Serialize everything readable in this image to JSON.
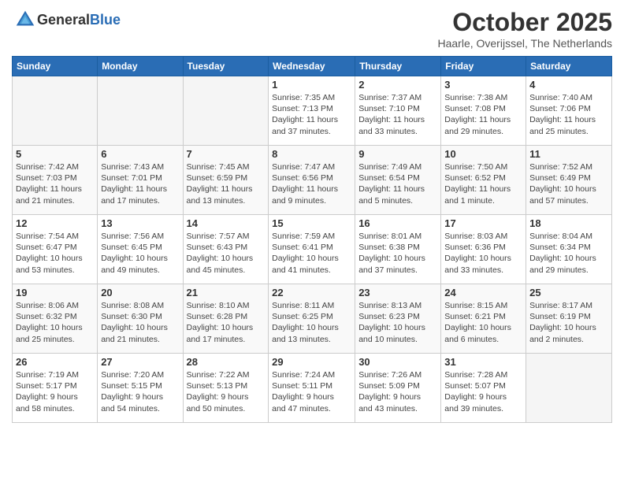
{
  "header": {
    "logo_general": "General",
    "logo_blue": "Blue",
    "month": "October 2025",
    "location": "Haarle, Overijssel, The Netherlands"
  },
  "weekdays": [
    "Sunday",
    "Monday",
    "Tuesday",
    "Wednesday",
    "Thursday",
    "Friday",
    "Saturday"
  ],
  "weeks": [
    [
      {
        "day": "",
        "info": ""
      },
      {
        "day": "",
        "info": ""
      },
      {
        "day": "",
        "info": ""
      },
      {
        "day": "1",
        "info": "Sunrise: 7:35 AM\nSunset: 7:13 PM\nDaylight: 11 hours\nand 37 minutes."
      },
      {
        "day": "2",
        "info": "Sunrise: 7:37 AM\nSunset: 7:10 PM\nDaylight: 11 hours\nand 33 minutes."
      },
      {
        "day": "3",
        "info": "Sunrise: 7:38 AM\nSunset: 7:08 PM\nDaylight: 11 hours\nand 29 minutes."
      },
      {
        "day": "4",
        "info": "Sunrise: 7:40 AM\nSunset: 7:06 PM\nDaylight: 11 hours\nand 25 minutes."
      }
    ],
    [
      {
        "day": "5",
        "info": "Sunrise: 7:42 AM\nSunset: 7:03 PM\nDaylight: 11 hours\nand 21 minutes."
      },
      {
        "day": "6",
        "info": "Sunrise: 7:43 AM\nSunset: 7:01 PM\nDaylight: 11 hours\nand 17 minutes."
      },
      {
        "day": "7",
        "info": "Sunrise: 7:45 AM\nSunset: 6:59 PM\nDaylight: 11 hours\nand 13 minutes."
      },
      {
        "day": "8",
        "info": "Sunrise: 7:47 AM\nSunset: 6:56 PM\nDaylight: 11 hours\nand 9 minutes."
      },
      {
        "day": "9",
        "info": "Sunrise: 7:49 AM\nSunset: 6:54 PM\nDaylight: 11 hours\nand 5 minutes."
      },
      {
        "day": "10",
        "info": "Sunrise: 7:50 AM\nSunset: 6:52 PM\nDaylight: 11 hours\nand 1 minute."
      },
      {
        "day": "11",
        "info": "Sunrise: 7:52 AM\nSunset: 6:49 PM\nDaylight: 10 hours\nand 57 minutes."
      }
    ],
    [
      {
        "day": "12",
        "info": "Sunrise: 7:54 AM\nSunset: 6:47 PM\nDaylight: 10 hours\nand 53 minutes."
      },
      {
        "day": "13",
        "info": "Sunrise: 7:56 AM\nSunset: 6:45 PM\nDaylight: 10 hours\nand 49 minutes."
      },
      {
        "day": "14",
        "info": "Sunrise: 7:57 AM\nSunset: 6:43 PM\nDaylight: 10 hours\nand 45 minutes."
      },
      {
        "day": "15",
        "info": "Sunrise: 7:59 AM\nSunset: 6:41 PM\nDaylight: 10 hours\nand 41 minutes."
      },
      {
        "day": "16",
        "info": "Sunrise: 8:01 AM\nSunset: 6:38 PM\nDaylight: 10 hours\nand 37 minutes."
      },
      {
        "day": "17",
        "info": "Sunrise: 8:03 AM\nSunset: 6:36 PM\nDaylight: 10 hours\nand 33 minutes."
      },
      {
        "day": "18",
        "info": "Sunrise: 8:04 AM\nSunset: 6:34 PM\nDaylight: 10 hours\nand 29 minutes."
      }
    ],
    [
      {
        "day": "19",
        "info": "Sunrise: 8:06 AM\nSunset: 6:32 PM\nDaylight: 10 hours\nand 25 minutes."
      },
      {
        "day": "20",
        "info": "Sunrise: 8:08 AM\nSunset: 6:30 PM\nDaylight: 10 hours\nand 21 minutes."
      },
      {
        "day": "21",
        "info": "Sunrise: 8:10 AM\nSunset: 6:28 PM\nDaylight: 10 hours\nand 17 minutes."
      },
      {
        "day": "22",
        "info": "Sunrise: 8:11 AM\nSunset: 6:25 PM\nDaylight: 10 hours\nand 13 minutes."
      },
      {
        "day": "23",
        "info": "Sunrise: 8:13 AM\nSunset: 6:23 PM\nDaylight: 10 hours\nand 10 minutes."
      },
      {
        "day": "24",
        "info": "Sunrise: 8:15 AM\nSunset: 6:21 PM\nDaylight: 10 hours\nand 6 minutes."
      },
      {
        "day": "25",
        "info": "Sunrise: 8:17 AM\nSunset: 6:19 PM\nDaylight: 10 hours\nand 2 minutes."
      }
    ],
    [
      {
        "day": "26",
        "info": "Sunrise: 7:19 AM\nSunset: 5:17 PM\nDaylight: 9 hours\nand 58 minutes."
      },
      {
        "day": "27",
        "info": "Sunrise: 7:20 AM\nSunset: 5:15 PM\nDaylight: 9 hours\nand 54 minutes."
      },
      {
        "day": "28",
        "info": "Sunrise: 7:22 AM\nSunset: 5:13 PM\nDaylight: 9 hours\nand 50 minutes."
      },
      {
        "day": "29",
        "info": "Sunrise: 7:24 AM\nSunset: 5:11 PM\nDaylight: 9 hours\nand 47 minutes."
      },
      {
        "day": "30",
        "info": "Sunrise: 7:26 AM\nSunset: 5:09 PM\nDaylight: 9 hours\nand 43 minutes."
      },
      {
        "day": "31",
        "info": "Sunrise: 7:28 AM\nSunset: 5:07 PM\nDaylight: 9 hours\nand 39 minutes."
      },
      {
        "day": "",
        "info": ""
      }
    ]
  ]
}
